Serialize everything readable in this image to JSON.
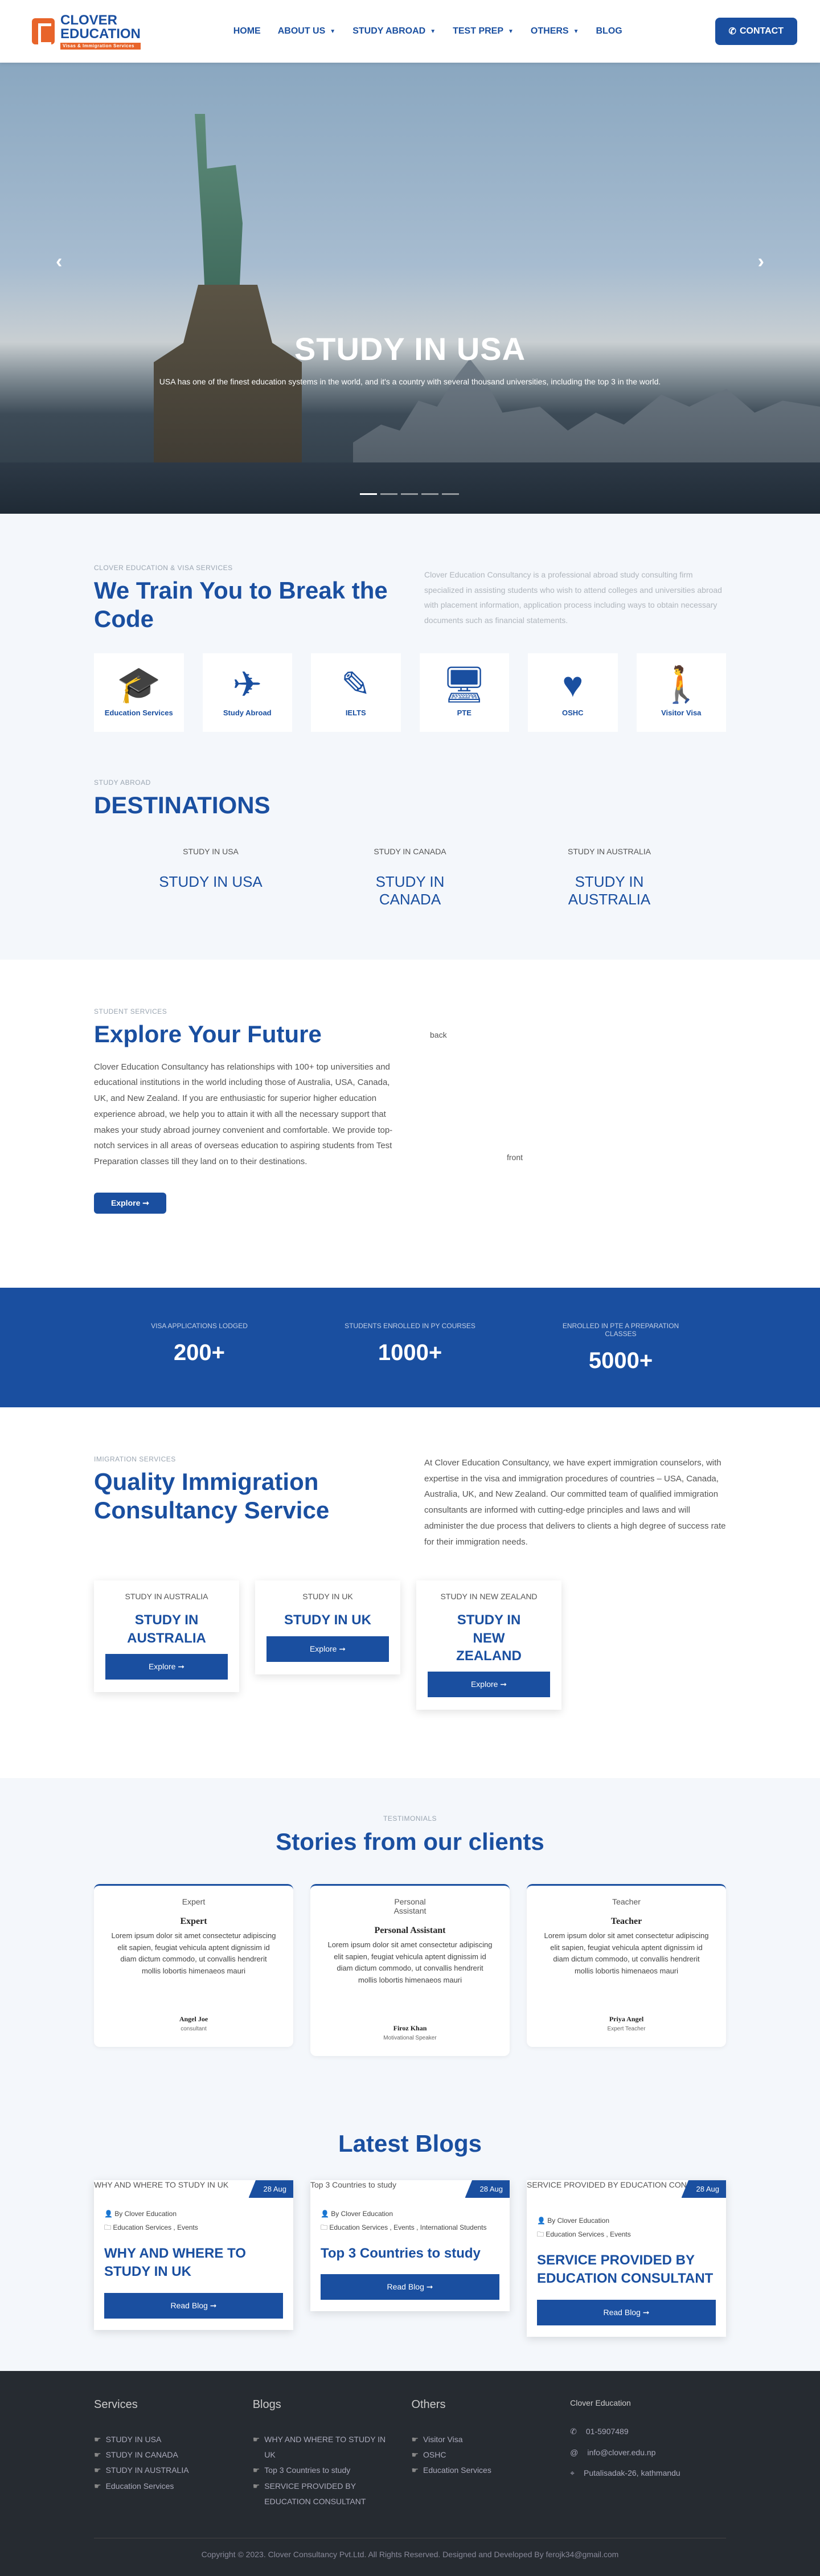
{
  "header": {
    "logo": {
      "line1": "CLOVER",
      "line2": "EDUCATION",
      "tagline": "Visas & Immigration Services"
    },
    "nav": [
      {
        "label": "HOME",
        "caret": false
      },
      {
        "label": "ABOUT US",
        "caret": true
      },
      {
        "label": "STUDY ABROAD",
        "caret": true
      },
      {
        "label": "TEST PREP",
        "caret": true
      },
      {
        "label": "OTHERS",
        "caret": true
      },
      {
        "label": "BLOG",
        "caret": false
      }
    ],
    "contact_label": "CONTACT"
  },
  "hero": {
    "title": "STUDY IN USA",
    "subtitle": "USA has one of the finest education systems in the world, and it's a country with several thousand universities, including the top 3 in the world.",
    "prev": "‹",
    "next": "›"
  },
  "train": {
    "eyebrow": "CLOVER EDUCATION & VISA SERVICES",
    "heading": "We Train You to Break the Code",
    "description": "Clover Education Consultancy is a professional abroad study consulting firm specialized in assisting students who wish to attend colleges and universities abroad with placement information, application process including ways to obtain necessary documents such as financial statements.",
    "services": [
      {
        "label": "Education Services",
        "icon": "graduate-icon",
        "glyph": "🎓"
      },
      {
        "label": "Study Abroad",
        "icon": "plane-icon",
        "glyph": "✈"
      },
      {
        "label": "IELTS",
        "icon": "pencil-icon",
        "glyph": "✎"
      },
      {
        "label": "PTE",
        "icon": "monitor-icon",
        "glyph": "🖥"
      },
      {
        "label": "OSHC",
        "icon": "heart-icon",
        "glyph": "♥"
      },
      {
        "label": "Visitor Visa",
        "icon": "hiker-icon",
        "glyph": "🚶"
      }
    ]
  },
  "destinations": {
    "eyebrow": "STUDY ABROAD",
    "heading": "DESTINATIONS",
    "items": [
      {
        "img_alt": "STUDY IN USA",
        "name": "STUDY IN USA"
      },
      {
        "img_alt": "STUDY IN CANADA",
        "name": "STUDY IN CANADA"
      },
      {
        "img_alt": "STUDY IN AUSTRALIA",
        "name": "STUDY IN AUSTRALIA"
      }
    ]
  },
  "explore": {
    "eyebrow": "STUDENT SERVICES",
    "heading": "Explore Your Future",
    "paragraph": "Clover Education Consultancy has relationships with 100+ top universities and educational institutions in the world including those of Australia, USA, Canada, UK, and New Zealand. If you are enthusiastic for superior higher education experience abroad, we help you to attain it with all the necessary support that makes your study abroad journey convenient and comfortable. We provide top-notch services in all areas of overseas education to aspiring students from Test Preparation classes till they land on to their destinations.",
    "button": "Explore ➞",
    "img_back_alt": "back",
    "img_front_alt": "front"
  },
  "stats": [
    {
      "label": "VISA APPLICATIONS LODGED",
      "value": "200+"
    },
    {
      "label": "STUDENTS ENROLLED IN PY COURSES",
      "value": "1000+"
    },
    {
      "label": "ENROLLED IN PTE A PREPARATION CLASSES",
      "value": "5000+"
    }
  ],
  "immigration": {
    "eyebrow": "IMIGRATION SERVICES",
    "heading": "Quality Immigration Consultancy Service",
    "description": "At Clover Education Consultancy, we have expert immigration counselors, with expertise in the visa and immigration procedures of countries – USA, Canada, Australia, UK, and New Zealand. Our committed team of qualified immigration consultants are informed with cutting-edge principles and laws and will administer the due process that delivers to clients a high degree of success rate for their immigration needs.",
    "cards": [
      {
        "img_alt": "STUDY IN AUSTRALIA",
        "name": "STUDY IN AUSTRALIA",
        "button": "Explore ➞"
      },
      {
        "img_alt": "STUDY IN UK",
        "name": "STUDY IN UK",
        "button": "Explore ➞"
      },
      {
        "img_alt": "STUDY IN NEW ZEALAND",
        "name": "STUDY IN NEW ZEALAND",
        "button": "Explore ➞"
      }
    ]
  },
  "testimonials": {
    "eyebrow": "TESTIMONIALS",
    "heading": "Stories from our clients",
    "items": [
      {
        "img_alt": "Expert",
        "role": "Expert",
        "quote": "Lorem ipsum dolor sit amet consectetur adipiscing elit sapien, feugiat vehicula aptent dignissim id diam dictum commodo, ut convallis hendrerit mollis lobortis himenaeos mauri",
        "name": "Angel Joe",
        "title": "consultant"
      },
      {
        "img_alt": "Personal Assistant",
        "role": "Personal Assistant",
        "quote": "Lorem ipsum dolor sit amet consectetur adipiscing elit sapien, feugiat vehicula aptent dignissim id diam dictum commodo, ut convallis hendrerit mollis lobortis himenaeos mauri",
        "name": "Firoz Khan",
        "title": "Motivational Speaker"
      },
      {
        "img_alt": "Teacher",
        "role": "Teacher",
        "quote": "Lorem ipsum dolor sit amet consectetur adipiscing elit sapien, feugiat vehicula aptent dignissim id diam dictum commodo, ut convallis hendrerit mollis lobortis himenaeos mauri",
        "name": "Priya Angel",
        "title": "Expert Teacher"
      }
    ]
  },
  "blogs": {
    "heading": "Latest Blogs",
    "items": [
      {
        "img_alt": "WHY AND WHERE TO STUDY IN UK",
        "date": "28 Aug",
        "author": "By Clover Education",
        "categories": "Education Services , Events",
        "title": "WHY AND WHERE TO STUDY IN UK",
        "button": "Read Blog ➞"
      },
      {
        "img_alt": "Top 3 Countries to study",
        "date": "28 Aug",
        "author": "By Clover Education",
        "categories": "Education Services , Events , International Students",
        "title": "Top 3 Countries to study",
        "button": "Read Blog ➞"
      },
      {
        "img_alt": "SERVICE PROVIDED BY EDUCATION CONSULTANT",
        "date": "28 Aug",
        "author": "By Clover Education",
        "categories": "Education Services , Events",
        "title": "SERVICE PROVIDED BY EDUCATION CONSULTANT",
        "button": "Read Blog ➞"
      }
    ]
  },
  "footer": {
    "services": {
      "heading": "Services",
      "items": [
        "STUDY IN USA",
        "STUDY IN CANADA",
        "STUDY IN AUSTRALIA",
        "Education Services"
      ]
    },
    "blogs": {
      "heading": "Blogs",
      "items": [
        "WHY AND WHERE TO STUDY IN UK",
        "Top 3 Countries to study",
        "SERVICE PROVIDED BY EDUCATION CONSULTANT"
      ]
    },
    "others": {
      "heading": "Others",
      "items": [
        "Visitor Visa",
        "OSHC",
        "Education Services"
      ]
    },
    "contact": {
      "logo_alt": "Clover Education",
      "phone": "01-5907489",
      "email": "info@clover.edu.np",
      "address": "Putalisadak-26, kathmandu"
    },
    "copyright": "Copyright © 2023. Clover Consultancy Pvt.Ltd. All Rights Reserved. Designed and Developed By ferojk34@gmail.com"
  }
}
